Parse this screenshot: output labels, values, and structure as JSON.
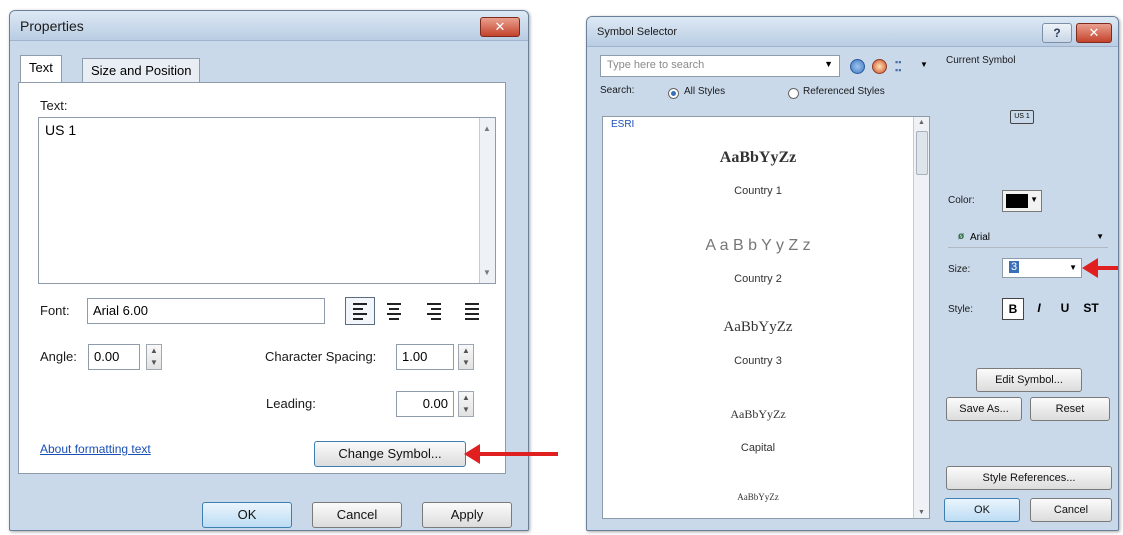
{
  "properties": {
    "title": "Properties",
    "close_glyph": "✕",
    "tabs": [
      "Text",
      "Size and Position"
    ],
    "text_label": "Text:",
    "text_value": "US 1",
    "font_label": "Font:",
    "font_value": "Arial 6.00",
    "angle_label": "Angle:",
    "angle_value": "0.00",
    "char_spacing_label": "Character Spacing:",
    "char_spacing_value": "1.00",
    "leading_label": "Leading:",
    "leading_value": "0.00",
    "about_link": "About formatting text",
    "change_symbol_label": "Change Symbol...",
    "ok_label": "OK",
    "cancel_label": "Cancel",
    "apply_label": "Apply"
  },
  "symbol_selector": {
    "title": "Symbol Selector",
    "help_glyph": "?",
    "close_glyph": "✕",
    "search_placeholder": "Type here to search",
    "search_label": "Search:",
    "all_styles_label": "All Styles",
    "referenced_styles_label": "Referenced Styles",
    "group_label": "ESRI",
    "symbols": [
      {
        "preview": "AaBbYyZz",
        "name": "Country 1"
      },
      {
        "preview": "A a B b Y y Z z",
        "name": "Country 2"
      },
      {
        "preview": "AaBbYyZz",
        "name": "Country 3"
      },
      {
        "preview": "AaBbYyZz",
        "name": "Capital"
      },
      {
        "preview": "AaBbYyZz",
        "name": ""
      }
    ],
    "current_symbol_label": "Current Symbol",
    "current_symbol_preview": "US 1",
    "color_label": "Color:",
    "color_value": "#000000",
    "font_value": "Arial",
    "size_label": "Size:",
    "size_value": "3",
    "style_label": "Style:",
    "style_buttons": [
      "B",
      "I",
      "U",
      "ST"
    ],
    "edit_symbol_label": "Edit Symbol...",
    "save_as_label": "Save As...",
    "reset_label": "Reset",
    "style_references_label": "Style References...",
    "ok_label": "OK",
    "cancel_label": "Cancel"
  }
}
